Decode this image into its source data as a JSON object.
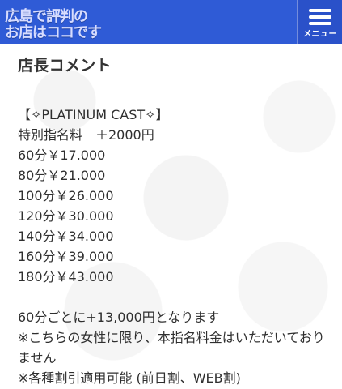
{
  "header": {
    "logo_line1": "広島で評判の",
    "logo_line2": "お店はココです",
    "menu_label": "メニュー"
  },
  "section": {
    "title": "店長コメント"
  },
  "content": {
    "lines": [
      "【✧PLATINUM CAST✧】",
      "特別指名料　＋2000円",
      "60分￥17.000",
      "80分￥21.000",
      "100分￥26.000",
      "120分￥30.000",
      "140分￥34.000",
      "160分￥39.000",
      "180分￥43.000"
    ],
    "notes": [
      "60分ごとに+13,000円となります",
      "※こちらの女性に限り、本指名料金はいただいておりません",
      "※各種割引適用可能 (前日割、WEB割)"
    ]
  },
  "colors": {
    "header_bg": "#2f5bd6",
    "menu_bg": "#2a51c9",
    "text": "#2f2f2f"
  }
}
